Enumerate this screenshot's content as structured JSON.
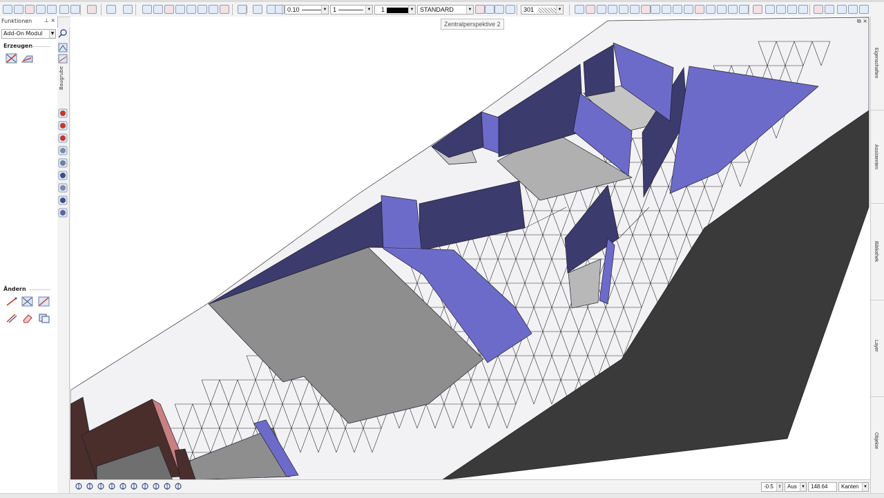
{
  "toolbar": {
    "pen_thickness": "0.10",
    "line_type": "1",
    "color_number": "1",
    "layer": "STANDARD",
    "material": "301"
  },
  "viewport": {
    "tooltip": "Zentralperspektive 2"
  },
  "palette": {
    "title": "Funktionen",
    "module": "Add-On Modul",
    "section_create": "Erzeugen",
    "section_modify": "Ändern",
    "strip_label": "Baugrube"
  },
  "right_tabs": [
    "Eigenschaften",
    "Assistenten",
    "Bibliothek",
    "Layer",
    "Objekte"
  ],
  "bottom_bar": {
    "offset_value": "-0.5",
    "mode": "Aus",
    "scale": "148.64",
    "display": "Kanten"
  },
  "colors": {
    "blue_wall": "#6d6bc9",
    "dark_wall": "#3c3b6d",
    "floor": "#8e8e8e",
    "terrain_cut": "#3a3a3a",
    "building": "#4a2e2c"
  }
}
